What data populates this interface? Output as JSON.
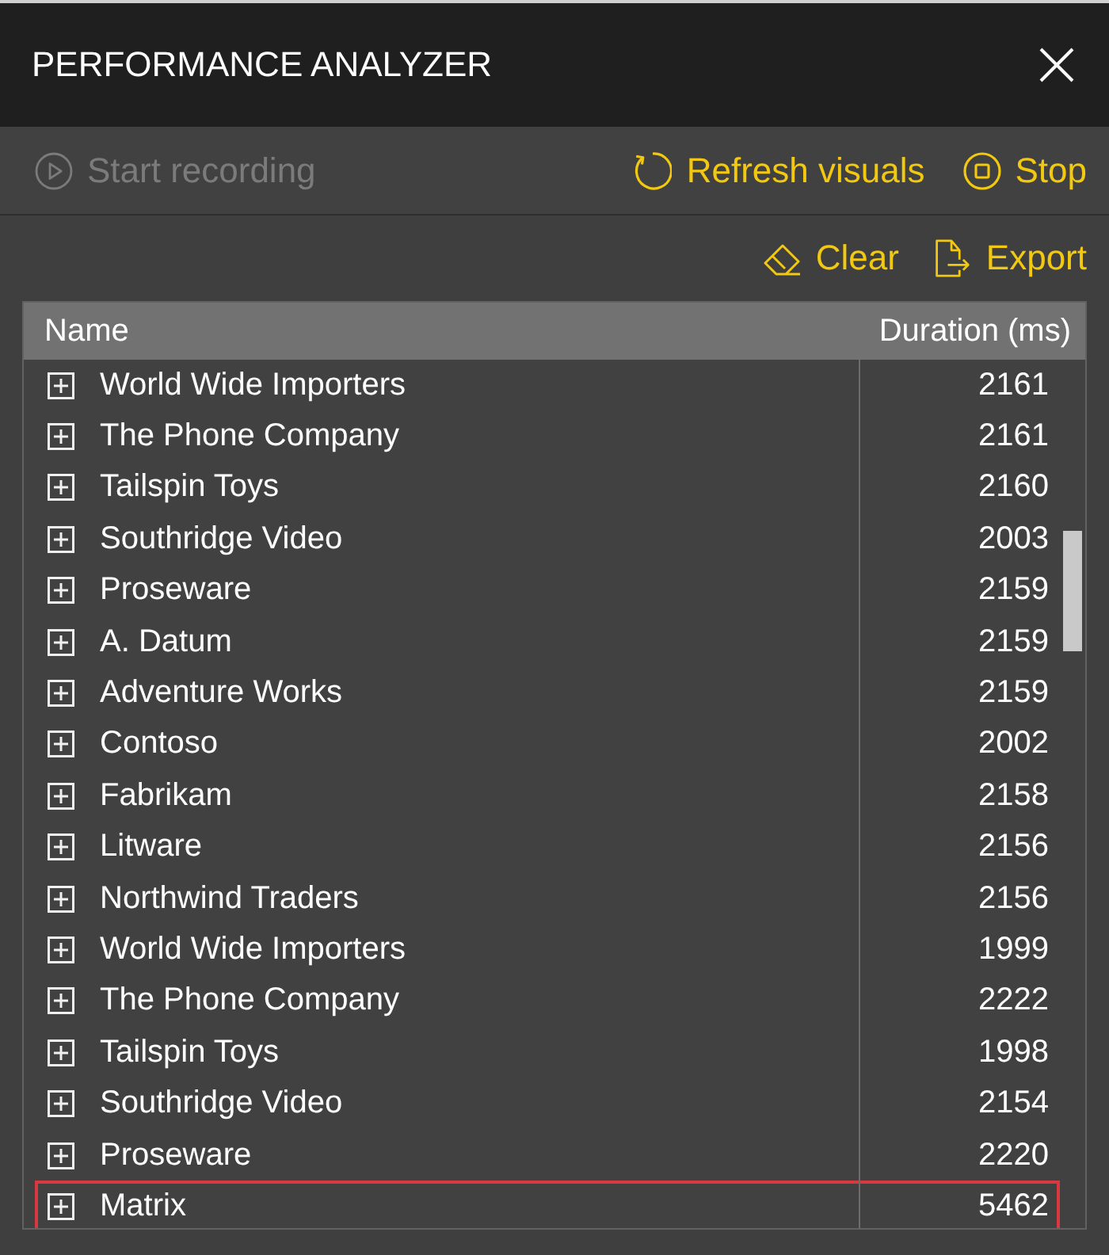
{
  "window": {
    "title": "PERFORMANCE ANALYZER"
  },
  "recording_bar": {
    "left": [
      {
        "kind": "record",
        "label": "Start recording",
        "disabled": true
      }
    ],
    "right": [
      {
        "kind": "refresh",
        "label": "Refresh visuals",
        "disabled": false
      },
      {
        "kind": "stop",
        "label": "Stop",
        "disabled": false
      }
    ]
  },
  "actions_bar": [
    {
      "kind": "clear",
      "label": "Clear",
      "disabled": false
    },
    {
      "kind": "export",
      "label": "Export",
      "disabled": false
    }
  ],
  "table": {
    "columns": [
      "Name",
      "Duration (ms)"
    ],
    "rows": [
      {
        "name": "World Wide Importers",
        "duration": "2161",
        "expanded": false,
        "highlighted": false
      },
      {
        "name": "The Phone Company",
        "duration": "2161",
        "expanded": false,
        "highlighted": false
      },
      {
        "name": "Tailspin Toys",
        "duration": "2160",
        "expanded": false,
        "highlighted": false
      },
      {
        "name": "Southridge Video",
        "duration": "2003",
        "expanded": false,
        "highlighted": false
      },
      {
        "name": "Proseware",
        "duration": "2159",
        "expanded": false,
        "highlighted": false
      },
      {
        "name": "A. Datum",
        "duration": "2159",
        "expanded": false,
        "highlighted": false
      },
      {
        "name": "Adventure Works",
        "duration": "2159",
        "expanded": false,
        "highlighted": false
      },
      {
        "name": "Contoso",
        "duration": "2002",
        "expanded": false,
        "highlighted": false
      },
      {
        "name": "Fabrikam",
        "duration": "2158",
        "expanded": false,
        "highlighted": false
      },
      {
        "name": "Litware",
        "duration": "2156",
        "expanded": false,
        "highlighted": false
      },
      {
        "name": "Northwind Traders",
        "duration": "2156",
        "expanded": false,
        "highlighted": false
      },
      {
        "name": "World Wide Importers",
        "duration": "1999",
        "expanded": false,
        "highlighted": false
      },
      {
        "name": "The Phone Company",
        "duration": "2222",
        "expanded": false,
        "highlighted": false
      },
      {
        "name": "Tailspin Toys",
        "duration": "1998",
        "expanded": false,
        "highlighted": false
      },
      {
        "name": "Southridge Video",
        "duration": "2154",
        "expanded": false,
        "highlighted": false
      },
      {
        "name": "Proseware",
        "duration": "2220",
        "expanded": false,
        "highlighted": false
      },
      {
        "name": "Matrix",
        "duration": "5462",
        "expanded": false,
        "highlighted": true
      }
    ]
  }
}
